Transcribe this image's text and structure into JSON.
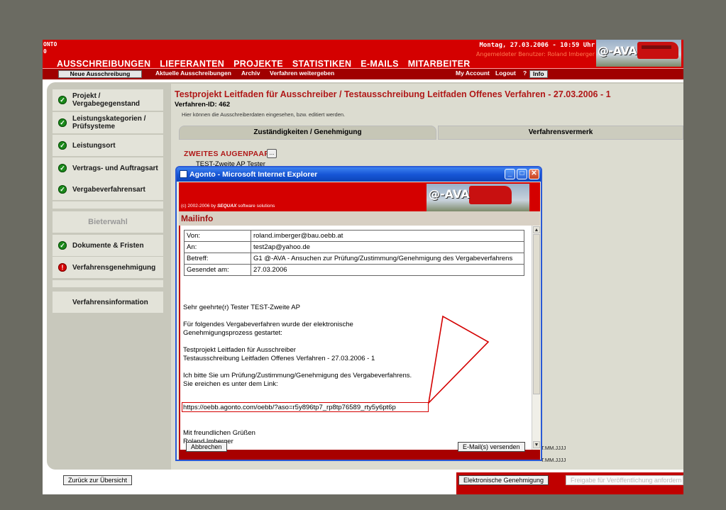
{
  "header": {
    "brand_line1": "ONTO",
    "brand_line2": "0",
    "datetime": "Montag, 27.03.2006 - 10:59 Uhr",
    "user_line": "Angemeldeter Benutzer: Roland Imberger",
    "logo_text": "@-AVA"
  },
  "main_nav": [
    "AUSSCHREIBUNGEN",
    "LIEFERANTEN",
    "PROJEKTE",
    "STATISTIKEN",
    "E-MAILS",
    "MITARBEITER"
  ],
  "sub_nav": {
    "new_tender": "Neue Ausschreibung",
    "current_tenders": "Aktuelle Ausschreibungen",
    "archive": "Archiv",
    "pass_on": "Verfahren weitergeben",
    "my_account": "My Account",
    "logout": "Logout",
    "help": "?",
    "info": "Info"
  },
  "sidebar": {
    "items": [
      {
        "label": "Projekt / Vergabegegenstand",
        "status": "ok"
      },
      {
        "label": "Leistungskategorien / Prüfsysteme",
        "status": "ok"
      },
      {
        "label": "Leistungsort",
        "status": "ok"
      },
      {
        "label": "Vertrags- und Auftragsart",
        "status": "ok"
      },
      {
        "label": "Vergabeverfahrensart",
        "status": "ok"
      },
      {
        "label": "Bieterwahl",
        "status": "disabled"
      },
      {
        "label": "Dokumente & Fristen",
        "status": "ok"
      },
      {
        "label": "Verfahrensgenehmigung",
        "status": "error"
      },
      {
        "label": "Verfahrensinformation",
        "status": "none"
      }
    ]
  },
  "page": {
    "title": "Testprojekt Leitfaden für Ausschreiber / Testausschreibung Leitfaden Offenes Verfahren - 27.03.2006 - 1",
    "procedure_id": "Verfahren-ID: 462",
    "hint": "Hier können die Ausschreiberdaten eingesehen, bzw. editiert werden.",
    "tabs": [
      "Zuständigkeiten / Genehmigung",
      "Verfahrensvermerk"
    ],
    "section_label": "ZWEITES AUGENPAAR",
    "section_button": "...",
    "section_value": "TEST-Zweite AP Tester",
    "date_format_1": "T.MM.JJJJ",
    "date_format_2": "T.MM.JJJJ"
  },
  "footer": {
    "back": "Zurück zur Übersicht",
    "electronic_approval": "Elektronische Genehmigung",
    "request_release": "Freigabe für Veröffentlichung anfordern"
  },
  "dialog": {
    "window_title": "Agonto - Microsoft Internet Explorer",
    "copyright_prefix": "(c) 2002-2006 by ",
    "copyright_brand": "SEQUAX",
    "copyright_suffix": " software solutions",
    "logo_text": "@-AVA",
    "heading": "Mailinfo",
    "fields": [
      {
        "label": "Von:",
        "value": "roland.imberger@bau.oebb.at"
      },
      {
        "label": "An:",
        "value": "test2ap@yahoo.de"
      },
      {
        "label": "Betreff:",
        "value": "G1 @-AVA - Ansuchen zur Prüfung/Zustimmung/Genehmigung des Vergabeverfahrens"
      },
      {
        "label": "Gesendet am:",
        "value": "27.03.2006"
      }
    ],
    "body": {
      "greeting": "Sehr geehrte(r)  Tester TEST-Zweite AP",
      "p1_line1": "Für folgendes Vergabeverfahren wurde der elektronische",
      "p1_line2": "Genehmigungsprozess gestartet:",
      "p2_line1": "Testprojekt Leitfaden für Ausschreiber",
      "p2_line2": "Testausschreibung Leitfaden Offenes Verfahren - 27.03.2006 - 1",
      "p3_line1": "Ich bitte Sie um Prüfung/Zustimmung/Genehmigung des Vergabeverfahrens.",
      "p3_line2": "Sie ereichen es unter dem Link:",
      "link": "https://oebb.agonto.com/oebb/?aso=r5y896tp7_rp8tp76589_rty5y6pt6p",
      "closing": "Mit freundlichen Grüßen",
      "signature": "Roland Imberger"
    },
    "cancel": "Abbrechen",
    "send": "E-Mail(s) versenden"
  },
  "colors": {
    "brand_red": "#d40000",
    "dark_red": "#a00000",
    "title_red": "#b01818",
    "ok_green": "#1b8a1b"
  }
}
